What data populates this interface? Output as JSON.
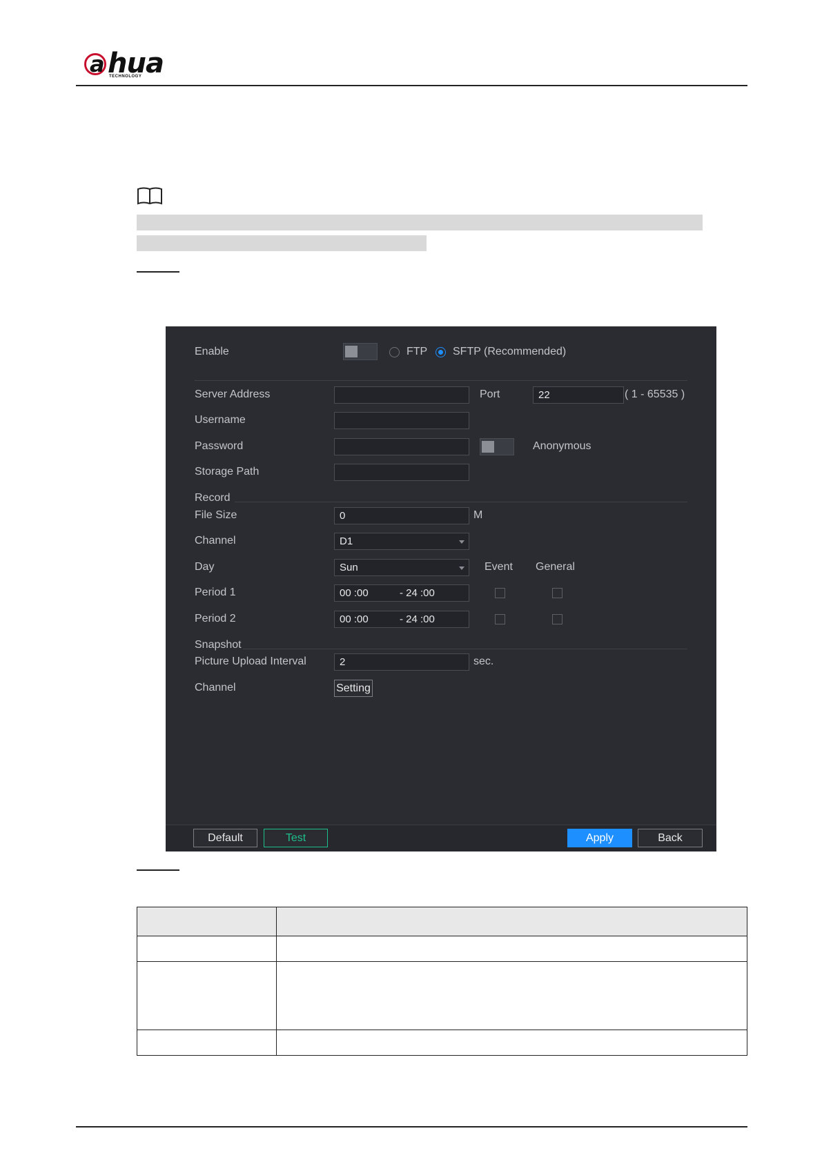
{
  "logo": {
    "word": "alhua",
    "tag": "TECHNOLOGY"
  },
  "panel": {
    "enable_label": "Enable",
    "protocols": [
      {
        "label": "FTP",
        "selected": false
      },
      {
        "label": "SFTP (Recommended)",
        "selected": true
      }
    ],
    "server_address_label": "Server Address",
    "server_address_value": "",
    "port_label": "Port",
    "port_value": "22",
    "port_range": "( 1 - 65535 )",
    "username_label": "Username",
    "username_value": "",
    "password_label": "Password",
    "password_value": "",
    "anonymous_label": "Anonymous",
    "storage_path_label": "Storage Path",
    "storage_path_value": "",
    "record_section": "Record",
    "file_size_label": "File Size",
    "file_size_value": "0",
    "file_size_unit": "M",
    "record_channel_label": "Channel",
    "record_channel_value": "D1",
    "day_label": "Day",
    "day_value": "Sun",
    "event_header": "Event",
    "general_header": "General",
    "periods": [
      {
        "label": "Period 1",
        "start": "00 :00",
        "end": "- 24 :00",
        "event": false,
        "general": false
      },
      {
        "label": "Period 2",
        "start": "00 :00",
        "end": "- 24 :00",
        "event": false,
        "general": false
      }
    ],
    "snapshot_section": "Snapshot",
    "upload_interval_label": "Picture Upload Interval",
    "upload_interval_value": "2",
    "upload_interval_unit": "sec.",
    "snapshot_channel_label": "Channel",
    "setting_button": "Setting",
    "footer": {
      "default_label": "Default",
      "test_label": "Test",
      "apply_label": "Apply",
      "back_label": "Back"
    }
  },
  "colors": {
    "panel_bg": "#2a2c31",
    "accent_blue": "#1e8fff",
    "test_green": "#1fbf8a",
    "brand_red": "#c8102e"
  }
}
